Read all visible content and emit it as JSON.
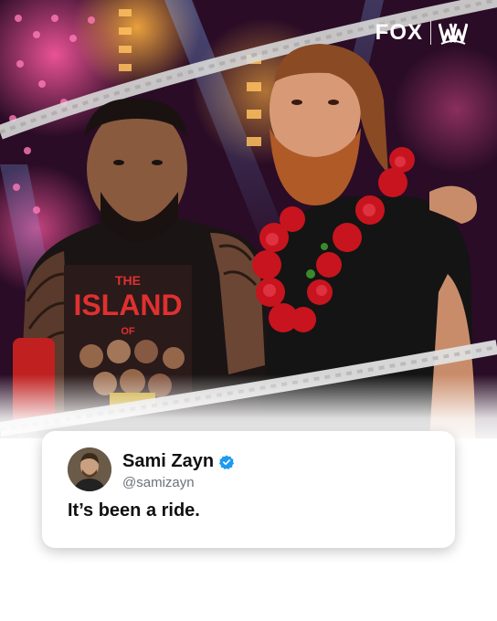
{
  "brand": {
    "network_logo": "FOX",
    "partner_logo": "WWE",
    "network_icon": "fox-logo-icon",
    "partner_icon": "wwe-logo-icon"
  },
  "photo": {
    "shirt_text_line1": "THE",
    "shirt_text_line2": "ISLAND",
    "shirt_text_line3": "OF"
  },
  "tweet": {
    "display_name": "Sami Zayn",
    "handle": "@samizayn",
    "text": "It’s been a ride.",
    "verified_icon": "verified-badge-icon",
    "verified_color": "#1d9bf0"
  }
}
